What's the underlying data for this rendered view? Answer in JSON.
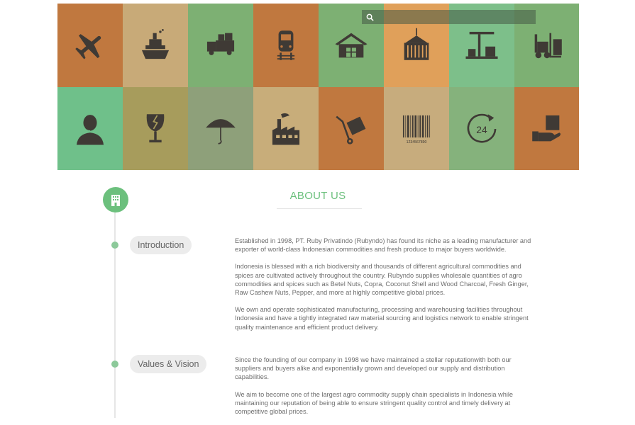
{
  "search": {
    "placeholder": ""
  },
  "banner": {
    "tiles": [
      {
        "icon": "airplane-icon",
        "color": "#c0783f"
      },
      {
        "icon": "ship-icon",
        "color": "#c8aa78"
      },
      {
        "icon": "truck-icon",
        "color": "#7db073"
      },
      {
        "icon": "train-icon",
        "color": "#c0783f"
      },
      {
        "icon": "warehouse-icon",
        "color": "#7db073"
      },
      {
        "icon": "container-crane-icon",
        "color": "#e0a05a"
      },
      {
        "icon": "port-crane-icon",
        "color": "#7dbf8a"
      },
      {
        "icon": "forklift-icon",
        "color": "#7db073"
      },
      {
        "icon": "customer-service-icon",
        "color": "#6fc08a"
      },
      {
        "icon": "fragile-glass-icon",
        "color": "#a79c5c"
      },
      {
        "icon": "umbrella-icon",
        "color": "#8ea07a"
      },
      {
        "icon": "factory-icon",
        "color": "#c8ad7a"
      },
      {
        "icon": "hand-truck-icon",
        "color": "#c0783f"
      },
      {
        "icon": "barcode-icon",
        "color": "#c7ac7d"
      },
      {
        "icon": "24-hour-service-icon",
        "color": "#85b27c"
      },
      {
        "icon": "package-hand-icon",
        "color": "#c0783f"
      }
    ],
    "barcode_number": "1234567890",
    "clock_label": "24"
  },
  "about": {
    "title": "ABOUT US"
  },
  "sections": {
    "introduction": {
      "label": "Introduction",
      "paragraphs": [
        "Established in 1998, PT. Ruby Privatindo (Rubyndo) has found its niche as a leading manufacturer and exporter of world-class Indonesian commodities and fresh produce to major buyers worldwide.",
        "Indonesia is blessed with a rich biodiversity and thousands of different agricultural commodities and spices are cultivated actively throughout the country. Rubyndo supplies wholesale quantities of agro commodities and spices such as Betel Nuts, Copra, Coconut Shell and Wood Charcoal, Fresh Ginger, Raw Cashew Nuts, Pepper, and more at highly competitive global prices.",
        "We own and operate sophisticated manufacturing, processing and warehousing facilities throughout Indonesia and have a tightly integrated raw material sourcing and logistics network to enable stringent quality maintenance and efficient product delivery."
      ]
    },
    "values": {
      "label": "Values & Vision",
      "paragraphs": [
        "Since the founding of our company in 1998 we have maintained a stellar reputationwith both our suppliers and buyers alike and exponentially grown and developed our supply and distribution capabilities.",
        "We aim to become one of the largest agro commodity supply chain specialists in Indonesia while maintaining our reputation of being able to ensure stringent quality control and timely delivery at competitive global prices."
      ]
    }
  }
}
